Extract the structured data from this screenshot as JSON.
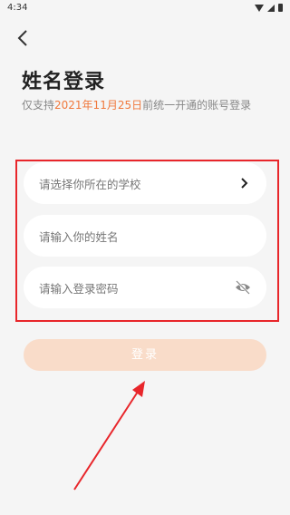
{
  "status_bar": {
    "time": "4:34"
  },
  "header": {
    "title": "姓名登录"
  },
  "notice": {
    "prefix": "仅支持",
    "date": "2021年11月25日",
    "suffix": "前统一开通的账号登录"
  },
  "form": {
    "school_placeholder": "请选择你所在的学校",
    "name_placeholder": "请输入你的姓名",
    "password_placeholder": "请输入登录密码"
  },
  "login_button": {
    "label": "登录"
  },
  "colors": {
    "accent": "#f0783c",
    "button_disabled": "#f9dcc9",
    "annotation": "#e8262b"
  },
  "icons": {
    "back": "chevron-left-icon",
    "select": "chevron-right-icon",
    "password_toggle": "eye-off-icon"
  }
}
